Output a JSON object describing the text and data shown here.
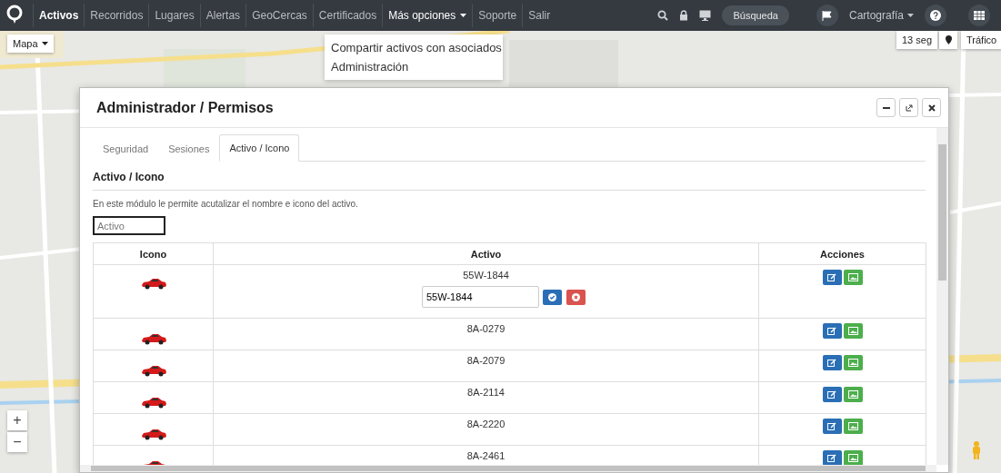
{
  "navbar": {
    "items": [
      {
        "label": "Activos",
        "selected": true,
        "dropdown": false
      },
      {
        "label": "Recorridos",
        "selected": false,
        "dropdown": false
      },
      {
        "label": "Lugares",
        "selected": false,
        "dropdown": false
      },
      {
        "label": "Alertas",
        "selected": false,
        "dropdown": false
      },
      {
        "label": "GeoCercas",
        "selected": false,
        "dropdown": false
      },
      {
        "label": "Certificados",
        "selected": false,
        "dropdown": false
      },
      {
        "label": "Más opciones",
        "selected": false,
        "dropdown": true,
        "expanded": true
      },
      {
        "label": "Soporte",
        "selected": false,
        "dropdown": false
      },
      {
        "label": "Salir",
        "selected": false,
        "dropdown": false
      }
    ],
    "search_button": "Búsqueda",
    "map_menu": "Cartografía"
  },
  "dropdown_menu": [
    "Compartir activos con asociados",
    "Administración"
  ],
  "map": {
    "map_type": "Mapa",
    "refresh": "13 seg",
    "traffic": "Tráfico",
    "zoom_in": "+",
    "zoom_out": "−"
  },
  "modal": {
    "title": "Administrador / Permisos",
    "tabs": [
      {
        "label": "Seguridad",
        "selected": false
      },
      {
        "label": "Sesiones",
        "selected": false
      },
      {
        "label": "Activo / Icono",
        "selected": true
      }
    ],
    "section_title": "Activo / Icono",
    "description": "En este módulo le permite acutalizar el nombre e icono del activo.",
    "filter": {
      "placeholder": "Activo"
    },
    "table": {
      "columns": [
        "Icono",
        "Activo",
        "Acciones"
      ],
      "rows": [
        {
          "name": "55W-1844",
          "editing": true,
          "edit_value": "55W-1844"
        },
        {
          "name": "8A-0279",
          "editing": false
        },
        {
          "name": "8A-2079",
          "editing": false
        },
        {
          "name": "8A-2114",
          "editing": false
        },
        {
          "name": "8A-2220",
          "editing": false
        },
        {
          "name": "8A-2461",
          "editing": false
        }
      ]
    }
  }
}
